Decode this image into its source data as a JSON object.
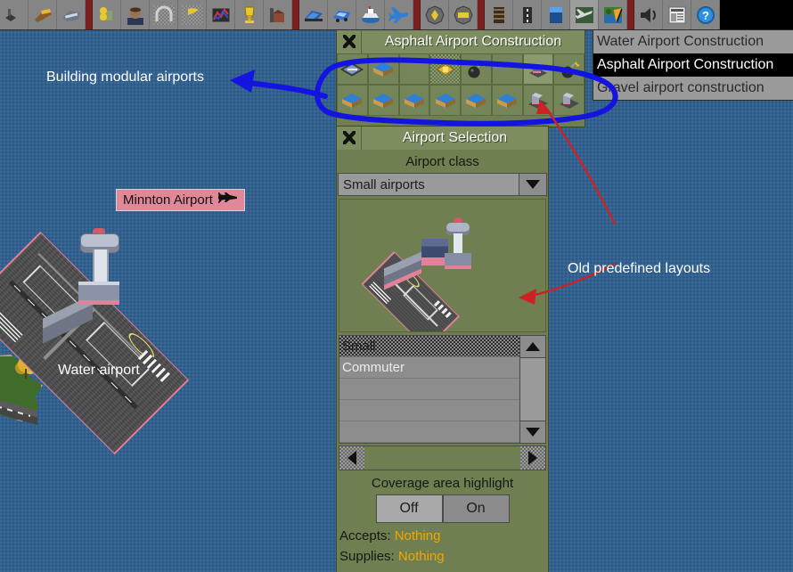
{
  "toolbar": {
    "items": [
      {
        "name": "pause-button",
        "icon": "pause"
      },
      {
        "name": "fast-forward-button",
        "icon": "fast-forward"
      },
      {
        "name": "options-button",
        "icon": "wrench"
      },
      {
        "name": "save-load-button",
        "icon": "disk"
      },
      {
        "name": "separator-1",
        "icon": "separator"
      },
      {
        "name": "town-directory-button",
        "icon": "town"
      },
      {
        "name": "subsidies-button",
        "icon": "face"
      },
      {
        "name": "station-list-button",
        "icon": "station"
      },
      {
        "name": "finances-button",
        "icon": "flag"
      },
      {
        "name": "company-league-button",
        "icon": "graph"
      },
      {
        "name": "trophy-button",
        "icon": "trophy"
      },
      {
        "name": "industry-button",
        "icon": "industry"
      },
      {
        "name": "separator-2",
        "icon": "separator"
      },
      {
        "name": "train-list-button",
        "icon": "train"
      },
      {
        "name": "road-vehicle-list-button",
        "icon": "bus"
      },
      {
        "name": "ship-list-button",
        "icon": "ship"
      },
      {
        "name": "aircraft-list-button",
        "icon": "plane"
      },
      {
        "name": "separator-3",
        "icon": "separator"
      },
      {
        "name": "zoom-in-button",
        "icon": "zoom-in"
      },
      {
        "name": "zoom-out-button",
        "icon": "zoom-out"
      },
      {
        "name": "separator-4",
        "icon": "separator"
      },
      {
        "name": "build-rail-button",
        "icon": "rail"
      },
      {
        "name": "build-road-button",
        "icon": "road"
      },
      {
        "name": "build-dock-button",
        "icon": "dock"
      },
      {
        "name": "build-airport-button",
        "icon": "airport"
      },
      {
        "name": "landscaping-button",
        "icon": "landscape"
      },
      {
        "name": "separator-5",
        "icon": "separator"
      },
      {
        "name": "sound-music-button",
        "icon": "speaker"
      },
      {
        "name": "message-history-button",
        "icon": "newspaper"
      },
      {
        "name": "help-button",
        "icon": "question"
      }
    ]
  },
  "construction_window": {
    "title": "Asphalt Airport Construction",
    "close_label": "✕",
    "row1": [
      {
        "name": "tool-runway-asphalt",
        "icon": "runway"
      },
      {
        "name": "tool-apron-blue",
        "icon": "apron"
      },
      {
        "name": "tool-empty-1",
        "icon": "empty"
      },
      {
        "name": "tool-buy-land",
        "icon": "land"
      },
      {
        "name": "tool-demolish",
        "icon": "dynamite"
      },
      {
        "name": "tool-empty-2",
        "icon": "empty"
      },
      {
        "name": "tool-terminal-building",
        "icon": "terminal"
      },
      {
        "name": "tool-demolish-2",
        "icon": "dynamite"
      }
    ],
    "row2": [
      {
        "name": "tool-apron-a",
        "icon": "apron"
      },
      {
        "name": "tool-apron-b",
        "icon": "apron"
      },
      {
        "name": "tool-apron-c",
        "icon": "apron"
      },
      {
        "name": "tool-apron-d",
        "icon": "apron"
      },
      {
        "name": "tool-apron-e",
        "icon": "apron"
      },
      {
        "name": "tool-apron-f",
        "icon": "apron"
      },
      {
        "name": "tool-predefined-1",
        "icon": "predefined"
      },
      {
        "name": "tool-predefined-2",
        "icon": "predefined"
      }
    ]
  },
  "dropdown": {
    "items": [
      {
        "label": "Water Airport Construction",
        "selected": false
      },
      {
        "label": "Asphalt Airport Construction",
        "selected": true
      },
      {
        "label": "Gravel airport construction",
        "selected": false
      }
    ]
  },
  "selection_window": {
    "title": "Airport Selection",
    "close_label": "✕",
    "class_label": "Airport class",
    "class_value": "Small airports",
    "dropdown_arrow": "▼",
    "list": [
      {
        "label": "Small",
        "selected": true
      },
      {
        "label": "Commuter",
        "selected": false
      },
      {
        "label": "",
        "selected": false
      },
      {
        "label": "",
        "selected": false
      },
      {
        "label": "",
        "selected": false
      }
    ],
    "scroll_up": "▲",
    "scroll_down": "▼",
    "scroll_left": "◀",
    "scroll_right": "▶",
    "coverage_label": "Coverage area highlight",
    "coverage_off": "Off",
    "coverage_on": "On",
    "accepts_label": "Accepts:",
    "accepts_value": "Nothing",
    "supplies_label": "Supplies:",
    "supplies_value": "Nothing"
  },
  "map": {
    "station_name": "Minnton Airport",
    "station_icon": "plane-icon"
  },
  "annotations": [
    {
      "name": "annotation-building-modular-airports",
      "text": "Building modular airports",
      "color": "#ffffff",
      "arrow_color": "#1414e0"
    },
    {
      "name": "annotation-water-airport",
      "text": "Water airport",
      "color": "#ffffff"
    },
    {
      "name": "annotation-old-predefined-layouts",
      "text": "Old predefined layouts",
      "color": "#ffffff",
      "arrow_color": "#cc2222"
    }
  ],
  "colors": {
    "sea": "#2e5f90",
    "window_bg": "#6f7f52",
    "title_bg": "#7d8d60",
    "toolbar_bg": "#858585",
    "accent_yellow": "#f0a800",
    "nameplate": "#e08898",
    "annotation_blue": "#1414e0",
    "annotation_red": "#cc2222"
  }
}
